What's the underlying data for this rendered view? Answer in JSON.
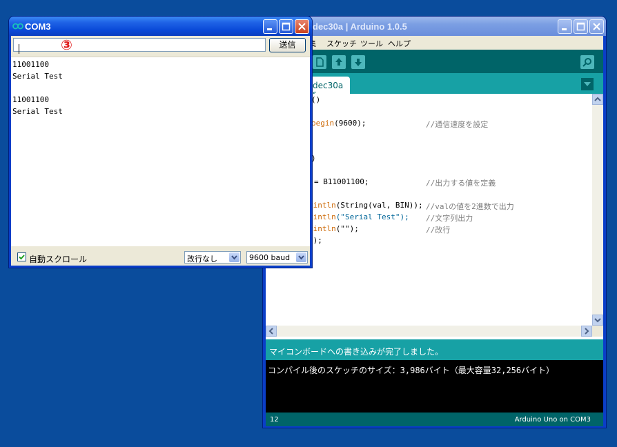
{
  "ide": {
    "title": "dec30a | Arduino 1.0.5",
    "menus": [
      "集",
      "スケッチ",
      "ツール",
      "ヘルプ"
    ],
    "tab_label": "dec30a §",
    "code": [
      {
        "a": "()",
        "b": "",
        "c": ""
      },
      {
        "a": "begin",
        "b": "(9600);",
        "c": "//通信速度を設定"
      },
      {
        "a": ")",
        "b": "",
        "c": ""
      },
      {
        "a": "= B11001100;",
        "b": "",
        "c": "//出力する値を定義"
      },
      {
        "a": "rintln",
        "b": "(String(val, BIN));",
        "c": "//valの値を2進数で出力"
      },
      {
        "a": "rintln",
        "b": "(\"Serial Test\");",
        "c": "//文字列出力"
      },
      {
        "a": "rintln",
        "b": "(\"\");",
        "c": "//改行"
      },
      {
        "a": "0);",
        "b": "",
        "c": ""
      }
    ],
    "status": "マイコンボードへの書き込みが完了しました。",
    "console": "コンパイル後のスケッチのサイズ：3,986バイト（最大容量32,256バイト）",
    "line_number": "12",
    "board": "Arduino Uno on COM3"
  },
  "com": {
    "title": "COM3",
    "marker": "③",
    "send_label": "送信",
    "output": [
      "11001100",
      "Serial Test",
      "",
      "11001100",
      "Serial Test"
    ],
    "autoscroll_label": "自動スクロール",
    "line_ending": "改行なし",
    "baud": "9600 baud"
  },
  "colors": {
    "desktop": "#0a4c9c",
    "arduino_dark": "#006468",
    "arduino_teal": "#17a1a5",
    "marker_red": "#e01b1b"
  }
}
